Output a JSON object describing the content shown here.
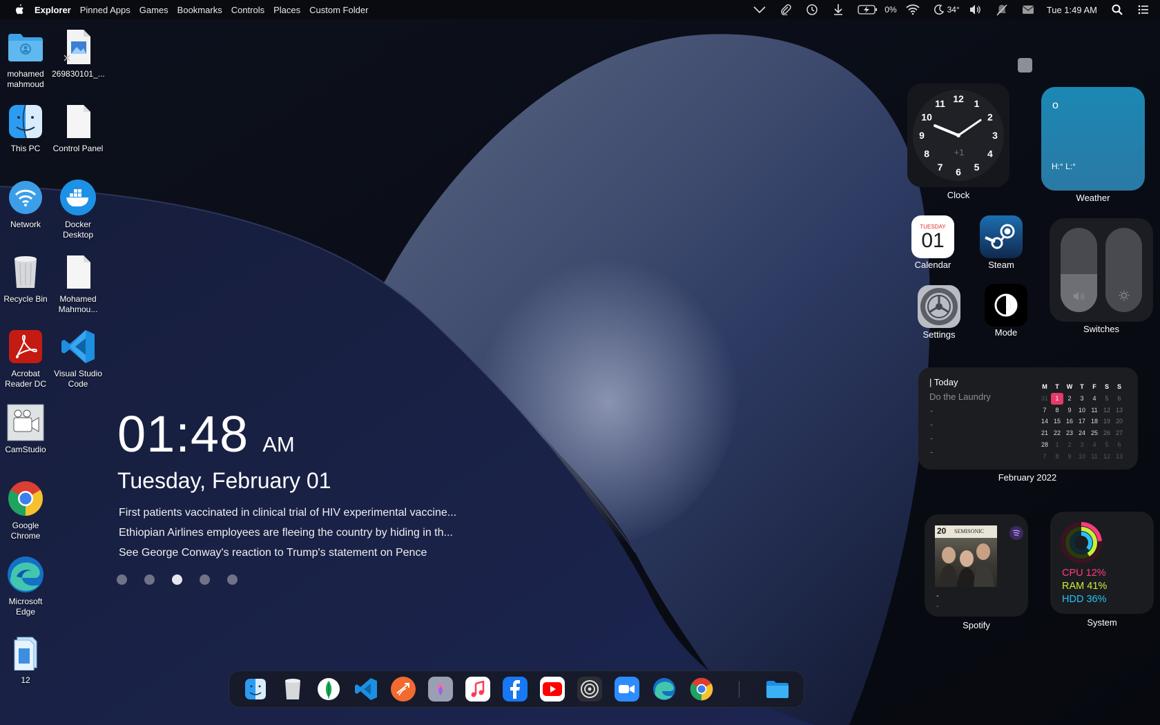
{
  "menubar": {
    "app_name": "Explorer",
    "items": [
      "Pinned Apps",
      "Games",
      "Bookmarks",
      "Controls",
      "Places",
      "Custom Folder"
    ],
    "battery": "0%",
    "temperature": "34°",
    "datetime": "Tue 1:49 AM",
    "tray_icons": [
      "chevron-down-icon",
      "paperclip-icon",
      "history-icon",
      "download-icon",
      "battery-icon",
      "wifi-icon",
      "moon-icon",
      "volume-icon",
      "mute-bell-icon",
      "mail-icon",
      "search-icon",
      "list-icon"
    ]
  },
  "desktop": {
    "icons": [
      {
        "label": "mohamed mahmoud",
        "icon": "user-folder-icon"
      },
      {
        "label": "269830101_...",
        "icon": "image-file-icon"
      },
      {
        "label": "This PC",
        "icon": "finder-icon"
      },
      {
        "label": "Control Panel",
        "icon": "document-icon"
      },
      {
        "label": "Network",
        "icon": "wifi-app-icon"
      },
      {
        "label": "Docker Desktop",
        "icon": "docker-icon"
      },
      {
        "label": "Recycle Bin",
        "icon": "trash-icon"
      },
      {
        "label": "Mohamed Mahmou...",
        "icon": "document-icon"
      },
      {
        "label": "Acrobat Reader DC",
        "icon": "acrobat-icon"
      },
      {
        "label": "Visual Studio Code",
        "icon": "vscode-icon"
      },
      {
        "label": "CamStudio",
        "icon": "camstudio-icon"
      },
      {
        "label": "Google Chrome",
        "icon": "chrome-icon"
      },
      {
        "label": "Microsoft Edge",
        "icon": "edge-icon"
      },
      {
        "label": "12",
        "icon": "file-stack-icon"
      }
    ]
  },
  "time_widget": {
    "time": "01:48",
    "ampm": "AM",
    "date": "Tuesday, February 01",
    "news": [
      "First patients vaccinated in clinical trial of HIV experimental vaccine...",
      "Ethiopian Airlines employees are fleeing the country by hiding in th...",
      "See George Conway's reaction to Trump's statement on Pence"
    ],
    "pager_active_index": 2,
    "pager_count": 5
  },
  "widgets": {
    "clock": {
      "label": "Clock",
      "offset": "+1",
      "numbers": [
        "12",
        "1",
        "2",
        "3",
        "4",
        "5",
        "6",
        "7",
        "8",
        "9",
        "10",
        "11"
      ]
    },
    "weather": {
      "label": "Weather",
      "temp": "o",
      "high_low": "H:° L:°"
    },
    "calendar_app": {
      "label": "Calendar",
      "weekday": "TUESDAY",
      "day": "01"
    },
    "steam": {
      "label": "Steam"
    },
    "settings": {
      "label": "Settings"
    },
    "mode": {
      "label": "Mode"
    },
    "switches": {
      "label": "Switches",
      "volume_level": 0.45,
      "brightness_level": 0.0
    },
    "todo": {
      "heading": "| Today",
      "task": "Do the Laundry",
      "placeholders": [
        "-",
        "-",
        "-",
        "-"
      ],
      "month_label": "February 2022",
      "weekdays": [
        "M",
        "T",
        "W",
        "T",
        "F",
        "S",
        "S"
      ],
      "weeks": [
        [
          "31",
          "1",
          "2",
          "3",
          "4",
          "5",
          "6"
        ],
        [
          "7",
          "8",
          "9",
          "10",
          "11",
          "12",
          "13"
        ],
        [
          "14",
          "15",
          "16",
          "17",
          "18",
          "19",
          "20"
        ],
        [
          "21",
          "22",
          "23",
          "24",
          "25",
          "26",
          "27"
        ],
        [
          "28",
          "1",
          "2",
          "3",
          "4",
          "5",
          "6"
        ],
        [
          "7",
          "8",
          "9",
          "10",
          "11",
          "12",
          "13"
        ]
      ],
      "today": "1"
    },
    "spotify": {
      "label": "Spotify",
      "album_band": "SEMISONIC",
      "album_badge": "20",
      "track": "-",
      "artist": "-"
    },
    "system": {
      "label": "System",
      "cpu": "CPU 12%",
      "ram": "RAM 41%",
      "hdd": "HDD 36%"
    }
  },
  "dock": {
    "apps": [
      "finder-icon",
      "trash-icon",
      "mongodb-icon",
      "vscode-icon",
      "swift-icon",
      "photos-icon",
      "music-icon",
      "facebook-icon",
      "youtube-icon",
      "settings-icon",
      "zoom-icon",
      "edge-icon",
      "chrome-icon",
      "folder-icon"
    ]
  },
  "colors": {
    "accent_red": "#e63a6c",
    "cpu": "#ff3b7f",
    "ram": "#c6f13a",
    "hdd": "#29c1f2",
    "weather_bg": "#1b88b4"
  }
}
